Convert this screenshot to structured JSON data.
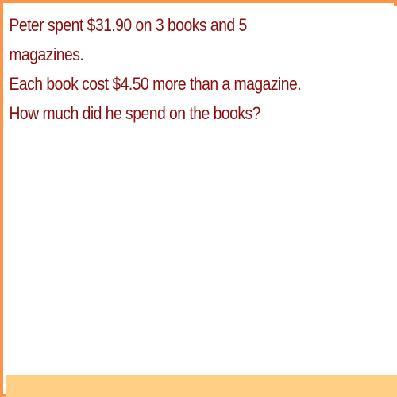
{
  "problem": {
    "lines": [
      "Peter spent $31.90 on 3 books and 5",
      "magazines.",
      "Each book cost $4.50 more than a magazine.",
      "How much did he spend on the books?"
    ]
  },
  "colors": {
    "border": "#ff9446",
    "text": "#8b0e0e",
    "footer": "#ffcf86",
    "background": "#ffffff"
  }
}
